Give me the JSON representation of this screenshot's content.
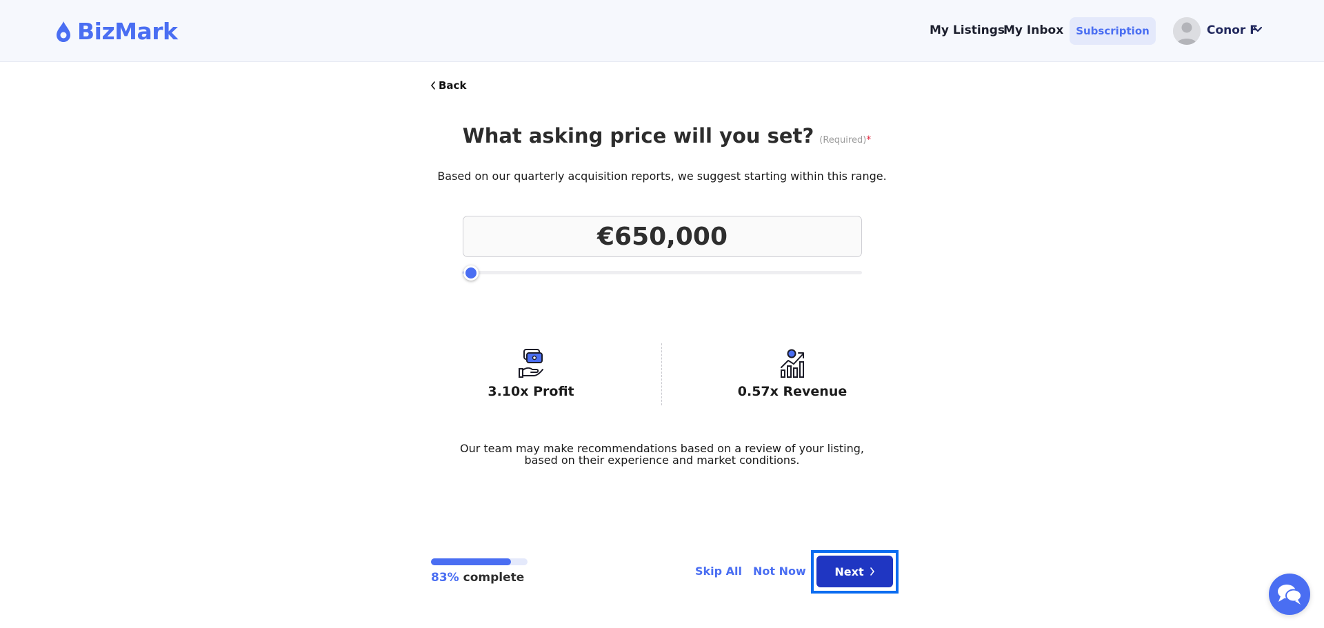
{
  "brand": {
    "name": "BizMark",
    "color": "#4a6ef2"
  },
  "nav": {
    "my_listings": "My Listings",
    "my_inbox": "My Inbox",
    "subscription": "Subscription",
    "user_name": "Conor F"
  },
  "back_label": "Back",
  "question": {
    "title": "What asking price will you set?",
    "required": "(Required)",
    "asterisk": "*",
    "subtitle": "Based on our quarterly acquisition reports, we suggest starting within this range."
  },
  "price": {
    "value": "€650,000",
    "slider_fraction": 0.02
  },
  "metrics": {
    "profit": {
      "label": "3.10x Profit",
      "icon": "money-hand-icon"
    },
    "revenue": {
      "label": "0.57x Revenue",
      "icon": "growth-chart-icon"
    }
  },
  "note": "Our team may make recommendations based on a review of your listing, based on their experience and market conditions.",
  "progress": {
    "percent_text": "83%",
    "suffix": "complete",
    "fraction": 0.83
  },
  "actions": {
    "skip_all": "Skip All",
    "not_now": "Not Now",
    "next": "Next"
  },
  "colors": {
    "accent": "#4a6ef2",
    "next_button": "#1f36c2",
    "focus_outline": "#0b6cf0",
    "required_star": "#e0223a"
  }
}
